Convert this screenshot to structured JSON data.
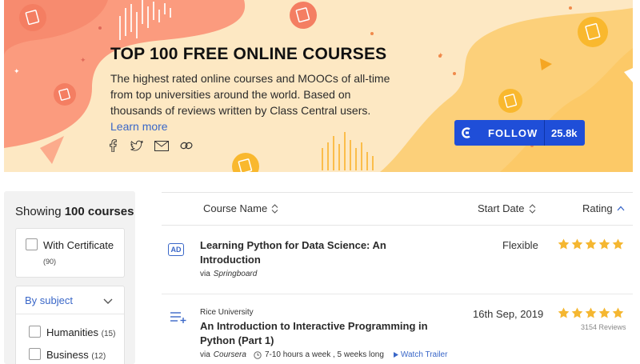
{
  "banner": {
    "title": "TOP 100 FREE ONLINE COURSES",
    "description": "The highest rated online courses and MOOCs of all-time from top universities around the world. Based on thousands of reviews written by Class Central users.",
    "learn_more": "Learn more",
    "share_icons": [
      "facebook-icon",
      "twitter-icon",
      "email-icon",
      "link-icon"
    ],
    "follow_label": "FOLLOW",
    "follow_count": "25.8k",
    "colors": {
      "background": "#fde8c3",
      "coral": "#fb9b7e",
      "yellow": "#fccb6a",
      "follow": "#1f4ed8"
    }
  },
  "sidebar": {
    "showing_prefix": "Showing",
    "showing_count": "100 courses",
    "certificate": {
      "label": "With Certificate",
      "count": "(90)"
    },
    "subject_heading": "By subject",
    "subjects": [
      {
        "label": "Humanities",
        "count": "(15)"
      },
      {
        "label": "Business",
        "count": "(12)"
      }
    ]
  },
  "list": {
    "headers": {
      "name": "Course Name",
      "start": "Start Date",
      "rating": "Rating"
    },
    "courses": [
      {
        "badge": "AD",
        "provider": "",
        "title": "Learning Python for Data Science: An Introduction",
        "via_prefix": "via",
        "platform": "Springboard",
        "start_date": "Flexible",
        "rating": 5,
        "reviews": ""
      },
      {
        "badge": "",
        "provider": "Rice University",
        "title": "An Introduction to Interactive Programming in Python (Part 1)",
        "via_prefix": "via",
        "platform": "Coursera",
        "effort": "7-10 hours a week , 5 weeks long",
        "trailer": "Watch Trailer",
        "start_date": "16th Sep, 2019",
        "rating": 5,
        "reviews": "3154 Reviews"
      }
    ],
    "star_color": "#f5b731"
  }
}
